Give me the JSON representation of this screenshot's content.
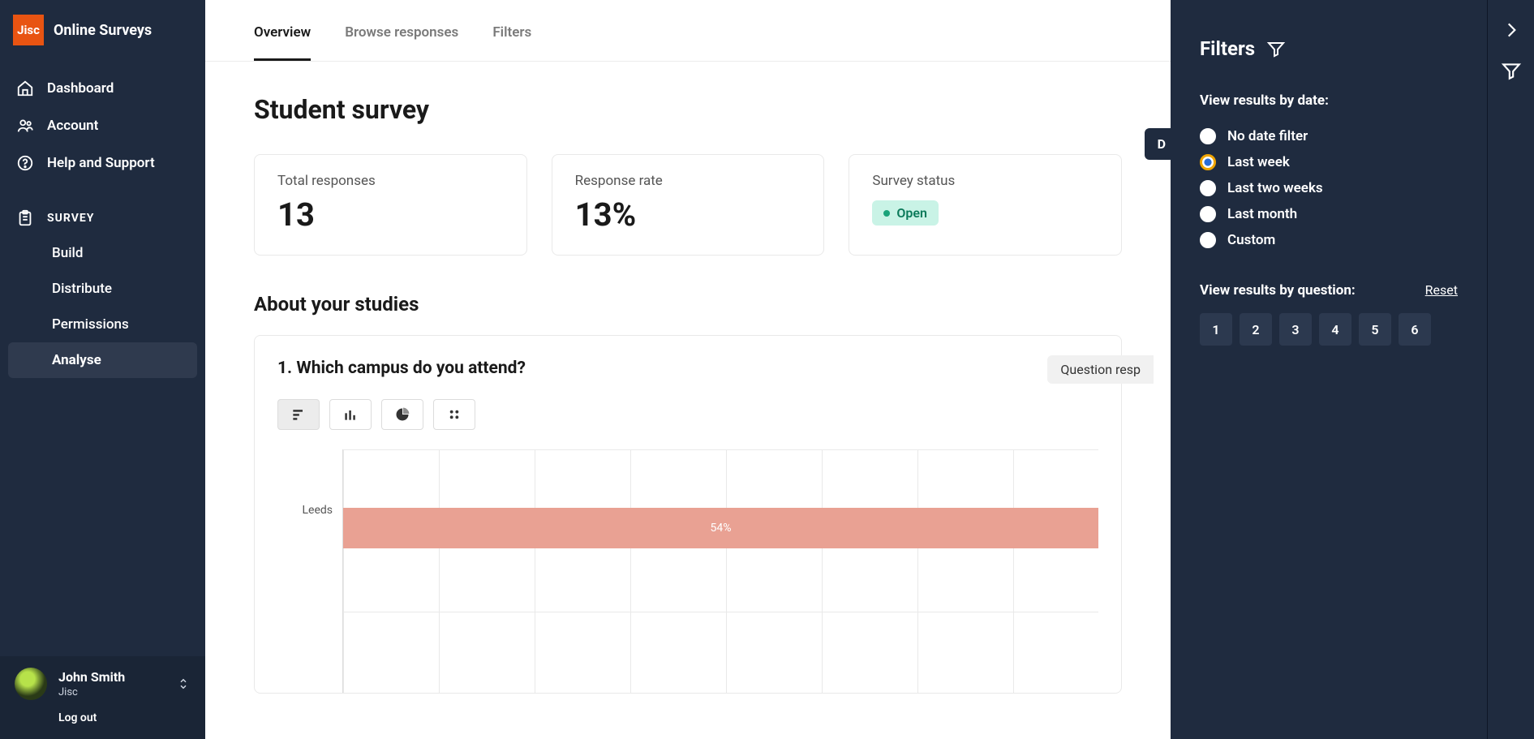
{
  "brand": {
    "logo_text": "Jisc",
    "name": "Online Surveys"
  },
  "sidebar": {
    "items": [
      {
        "label": "Dashboard"
      },
      {
        "label": "Account"
      },
      {
        "label": "Help and Support"
      }
    ],
    "survey_heading": "SURVEY",
    "survey_items": [
      {
        "label": "Build"
      },
      {
        "label": "Distribute"
      },
      {
        "label": "Permissions"
      },
      {
        "label": "Analyse"
      }
    ]
  },
  "user": {
    "name": "John Smith",
    "org": "Jisc",
    "logout": "Log out"
  },
  "tabs": [
    {
      "label": "Overview",
      "active": true
    },
    {
      "label": "Browse responses"
    },
    {
      "label": "Filters"
    }
  ],
  "survey": {
    "title": "Student survey",
    "download_label": "D",
    "stats": {
      "total_label": "Total responses",
      "total_value": "13",
      "rate_label": "Response rate",
      "rate_value": "13%",
      "status_label": "Survey status",
      "status_value": "Open"
    },
    "section_title": "About your studies",
    "question": {
      "text": "1. Which campus do you attend?",
      "responses_tag": "Question resp"
    }
  },
  "filters": {
    "title": "Filters",
    "date_heading": "View results by date:",
    "date_options": [
      {
        "label": "No date filter",
        "checked": false
      },
      {
        "label": "Last week",
        "checked": true
      },
      {
        "label": "Last two weeks",
        "checked": false
      },
      {
        "label": "Last month",
        "checked": false
      },
      {
        "label": "Custom",
        "checked": false
      }
    ],
    "question_heading": "View results by question:",
    "reset": "Reset",
    "question_numbers": [
      "1",
      "2",
      "3",
      "4",
      "5",
      "6"
    ]
  },
  "chart_data": {
    "type": "bar",
    "orientation": "horizontal",
    "categories": [
      "Leeds"
    ],
    "values": [
      54
    ],
    "value_labels": [
      "54%"
    ],
    "xlim": [
      0,
      100
    ],
    "title": "",
    "xlabel": "",
    "ylabel": ""
  }
}
